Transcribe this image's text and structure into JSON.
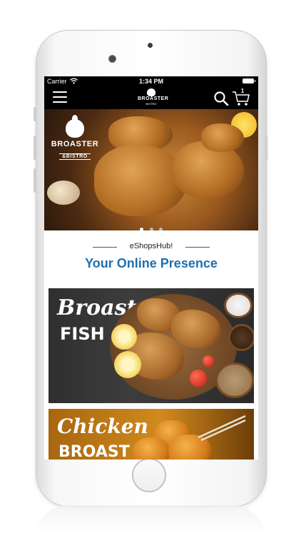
{
  "status_bar": {
    "carrier": "Carrier",
    "time": "1:34 PM"
  },
  "nav": {
    "cart_count": "1",
    "logo_text": "BROASTER",
    "logo_subtext": "BISTRO"
  },
  "hero": {
    "logo_line1": "BROASTER",
    "logo_line2": "&BISTRO",
    "slide_count": 3,
    "active_slide": 1
  },
  "tagline": {
    "subtitle": "eShopsHub!",
    "title": "Your Online Presence"
  },
  "banners": [
    {
      "title": "Broast",
      "subtitle": "FISH"
    },
    {
      "title": "Chicken",
      "subtitle": "BROAST"
    }
  ],
  "colors": {
    "accent": "#1f6fb0",
    "nav_bg": "#000000"
  }
}
